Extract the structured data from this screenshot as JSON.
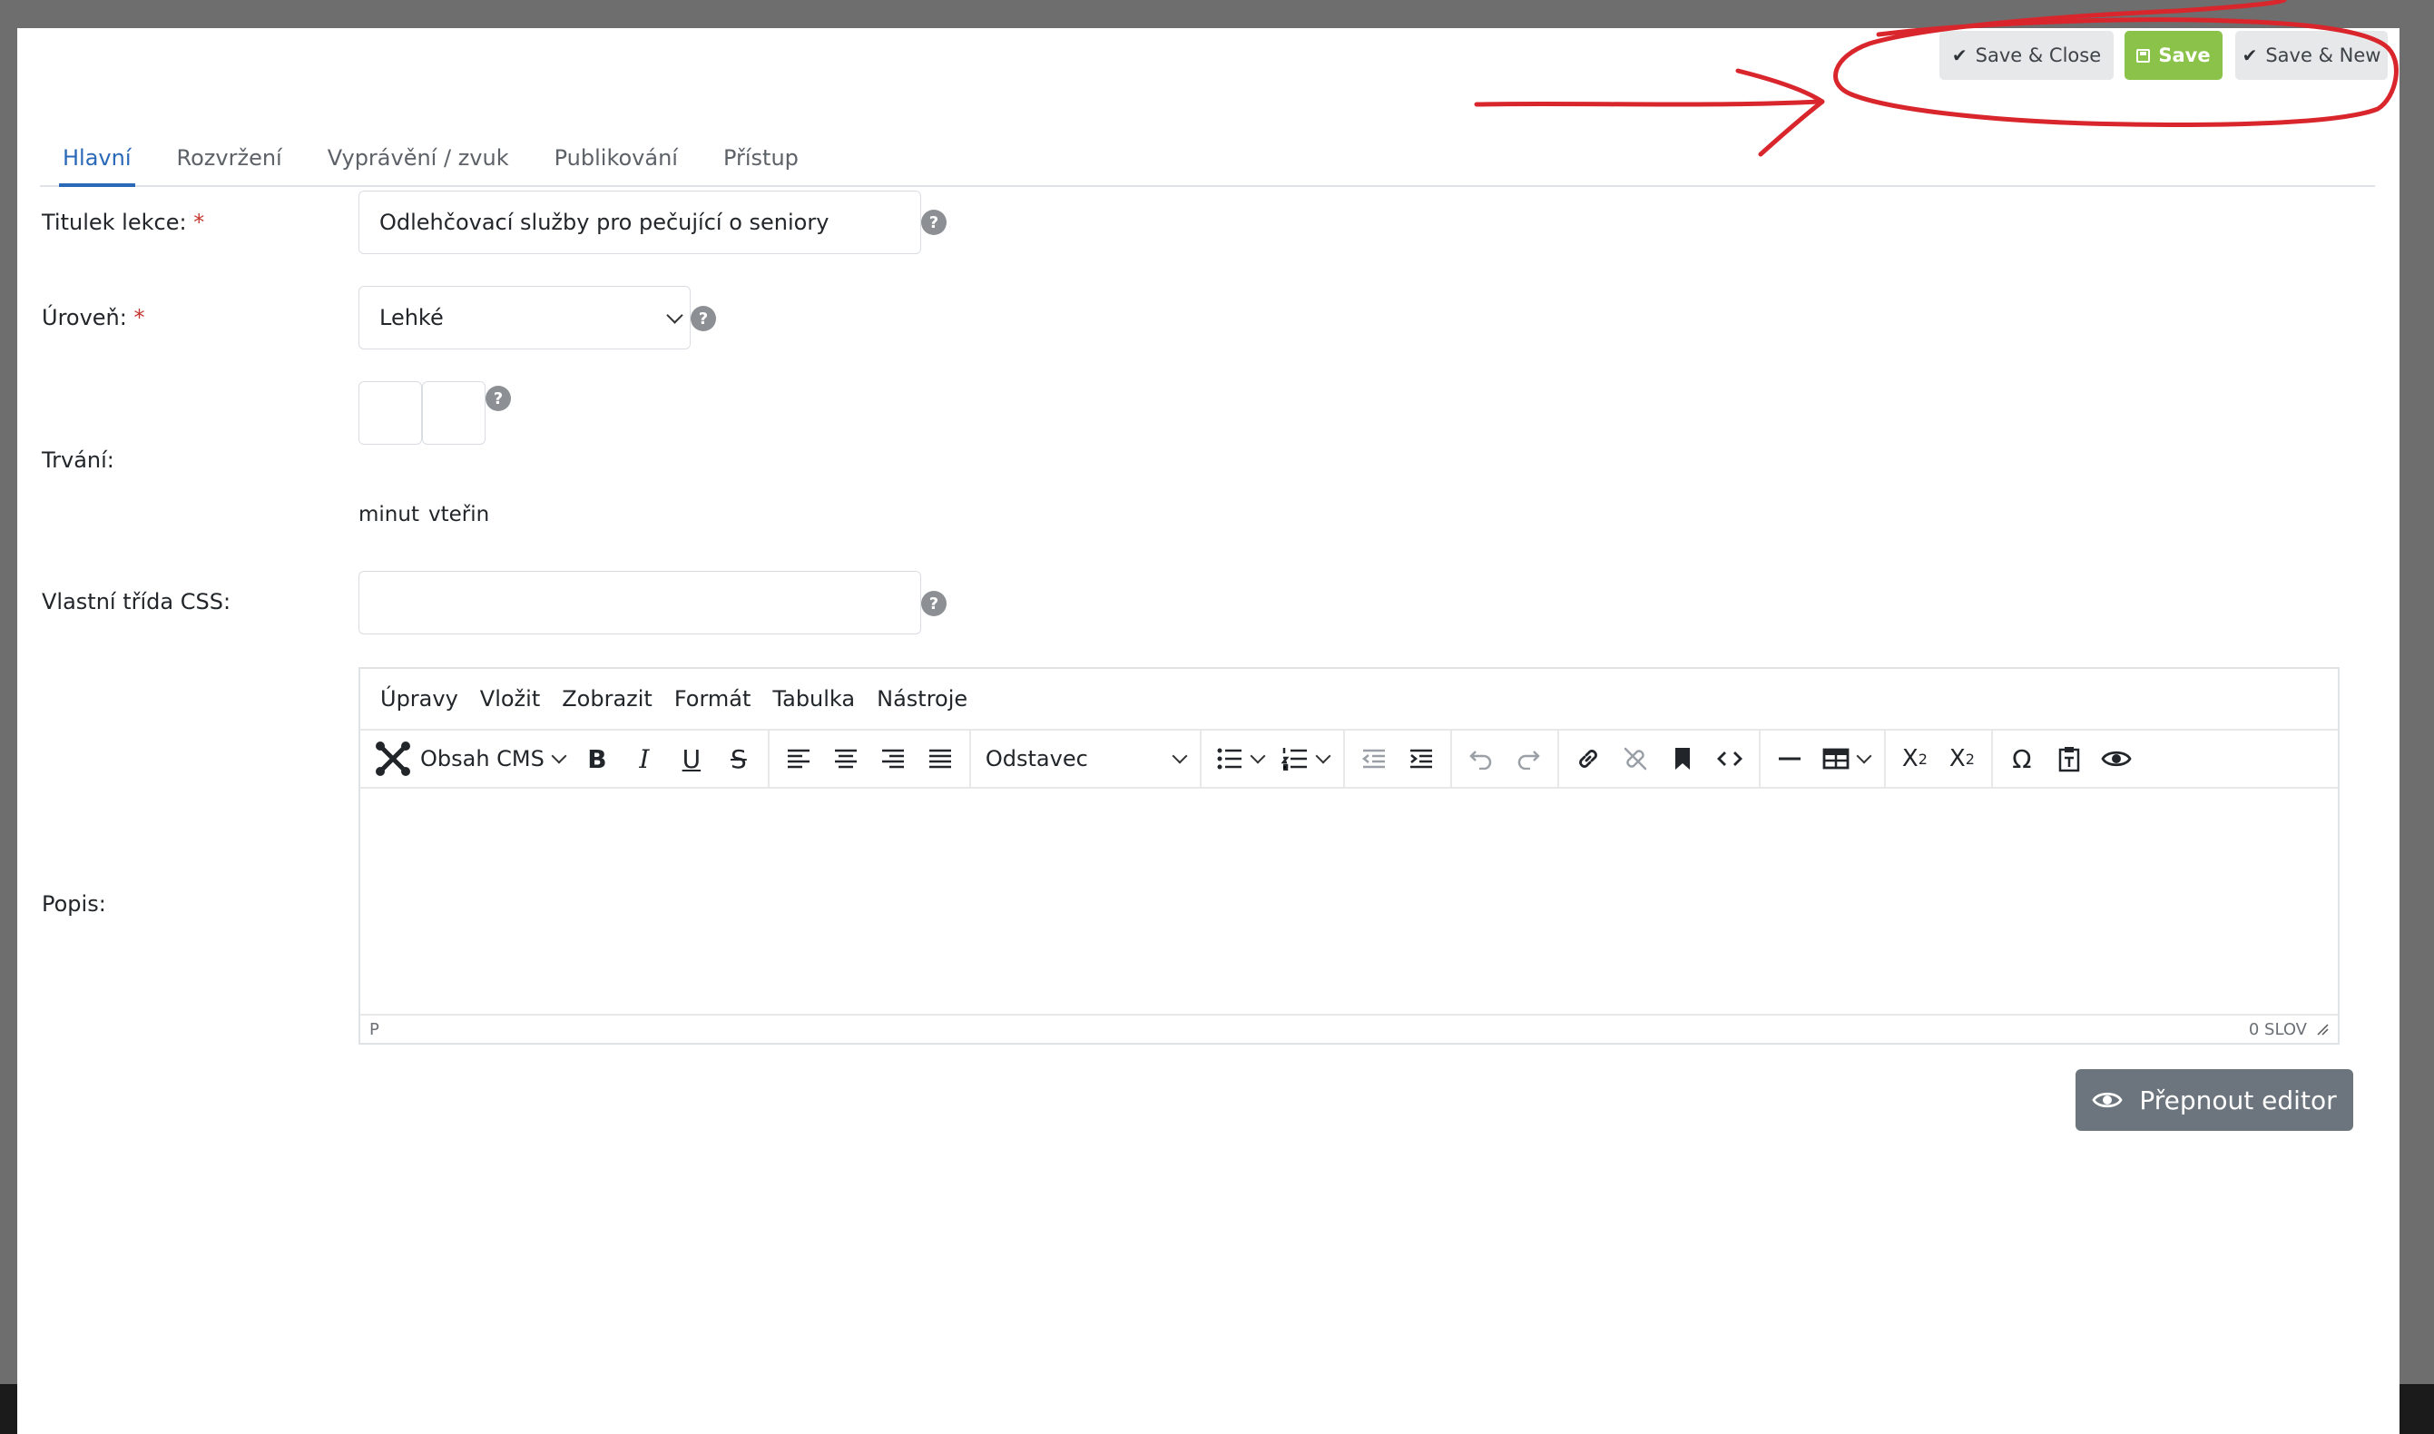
{
  "toolbar": {
    "save_close_label": "Save & Close",
    "save_label": "Save",
    "save_new_label": "Save & New"
  },
  "tabs": [
    {
      "label": "Hlavní",
      "active": true
    },
    {
      "label": "Rozvržení",
      "active": false
    },
    {
      "label": "Vyprávění / zvuk",
      "active": false
    },
    {
      "label": "Publikování",
      "active": false
    },
    {
      "label": "Přístup",
      "active": false
    }
  ],
  "form": {
    "title": {
      "label": "Titulek lekce:",
      "required_mark": "*",
      "value": "Odlehčovací služby pro pečující o seniory"
    },
    "level": {
      "label": "Úroveň:",
      "required_mark": "*",
      "value": "Lehké"
    },
    "duration": {
      "label": "Trvání:",
      "minutes_label": "minut",
      "seconds_label": "vteřin"
    },
    "css_class": {
      "label": "Vlastní třída CSS:",
      "value": ""
    },
    "description": {
      "label": "Popis:"
    },
    "help_glyph": "?"
  },
  "editor": {
    "menu": [
      "Úpravy",
      "Vložit",
      "Zobrazit",
      "Formát",
      "Tabulka",
      "Nástroje"
    ],
    "cms_label": "Obsah CMS",
    "block_format": "Odstavec",
    "status_path": "P",
    "word_count": "0 SLOV"
  },
  "switch_editor_label": "Přepnout editor",
  "colors": {
    "accent": "#2a69b8",
    "save_green": "#8bc34a",
    "annotation_red": "#d9262c"
  }
}
